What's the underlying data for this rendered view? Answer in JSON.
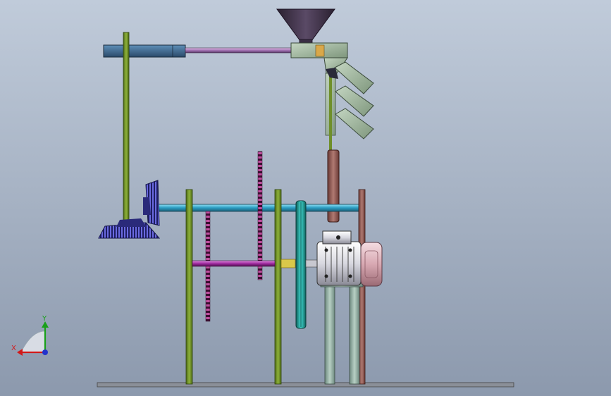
{
  "viewport": {
    "background_top": "#c0cbda",
    "background_bottom": "#8c99ad"
  },
  "triad": {
    "x_label": "X",
    "y_label": "Y",
    "x_color": "#d11a1a",
    "y_color": "#19a019",
    "z_color": "#2233cc"
  },
  "parts": {
    "frame_color": "#6f8f2a",
    "shaft_color": "#2a9bc0",
    "hopper_color": "#4a4055",
    "chain_color": "#7a2a6a",
    "motor_color": "#e8e8ee",
    "pulley_color": "#2fb7b0",
    "fan_color": "#e0b8c0",
    "bevel_gear_color": "#3a3aa0",
    "chute_color": "#a9c0a7"
  }
}
